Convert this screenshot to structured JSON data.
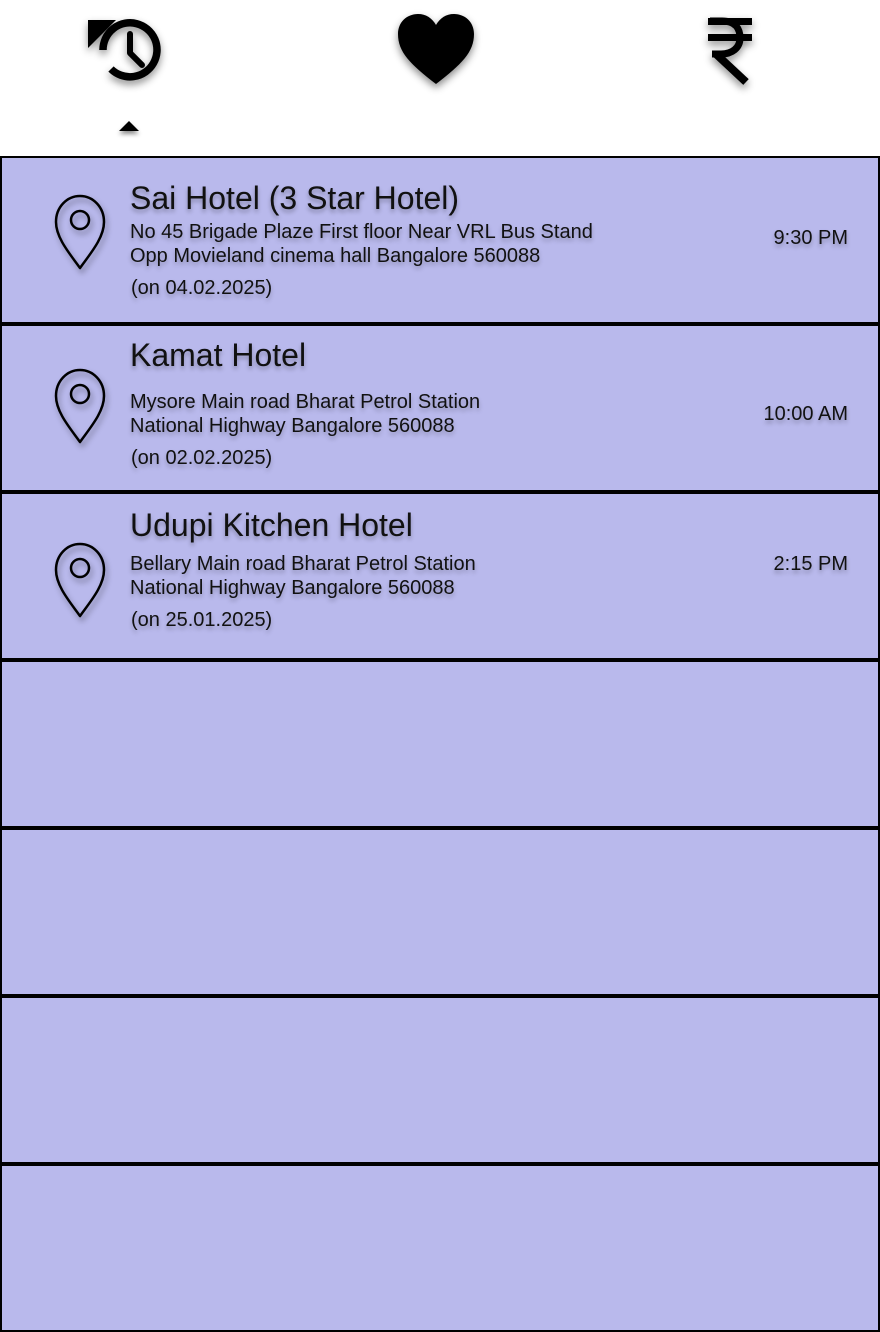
{
  "tabs": [
    {
      "name": "history",
      "icon": "history-icon",
      "active": true
    },
    {
      "name": "favorites",
      "icon": "heart-icon",
      "active": false
    },
    {
      "name": "payments",
      "icon": "rupee-icon",
      "active": false
    }
  ],
  "colors": {
    "row_background": "#b9b9ec",
    "row_border": "#000000",
    "icon": "#000000"
  },
  "history": {
    "entries": [
      {
        "title": "Sai Hotel (3 Star Hotel)",
        "address": "No 45 Brigade Plaze First floor Near VRL Bus Stand\nOpp Movieland cinema hall Bangalore 560088",
        "date": "(on 04.02.2025)",
        "time": "9:30 PM",
        "icon": "location-pin-icon"
      },
      {
        "title": "Kamat Hotel",
        "address": "Mysore Main road Bharat Petrol Station\nNational Highway Bangalore 560088",
        "date": "(on 02.02.2025)",
        "time": "10:00 AM",
        "icon": "location-pin-icon"
      },
      {
        "title": "Udupi Kitchen Hotel",
        "address": "Bellary Main road Bharat Petrol Station\nNational Highway Bangalore 560088",
        "date": "(on 25.01.2025)",
        "time": "2:15 PM",
        "icon": "location-pin-icon"
      }
    ]
  }
}
